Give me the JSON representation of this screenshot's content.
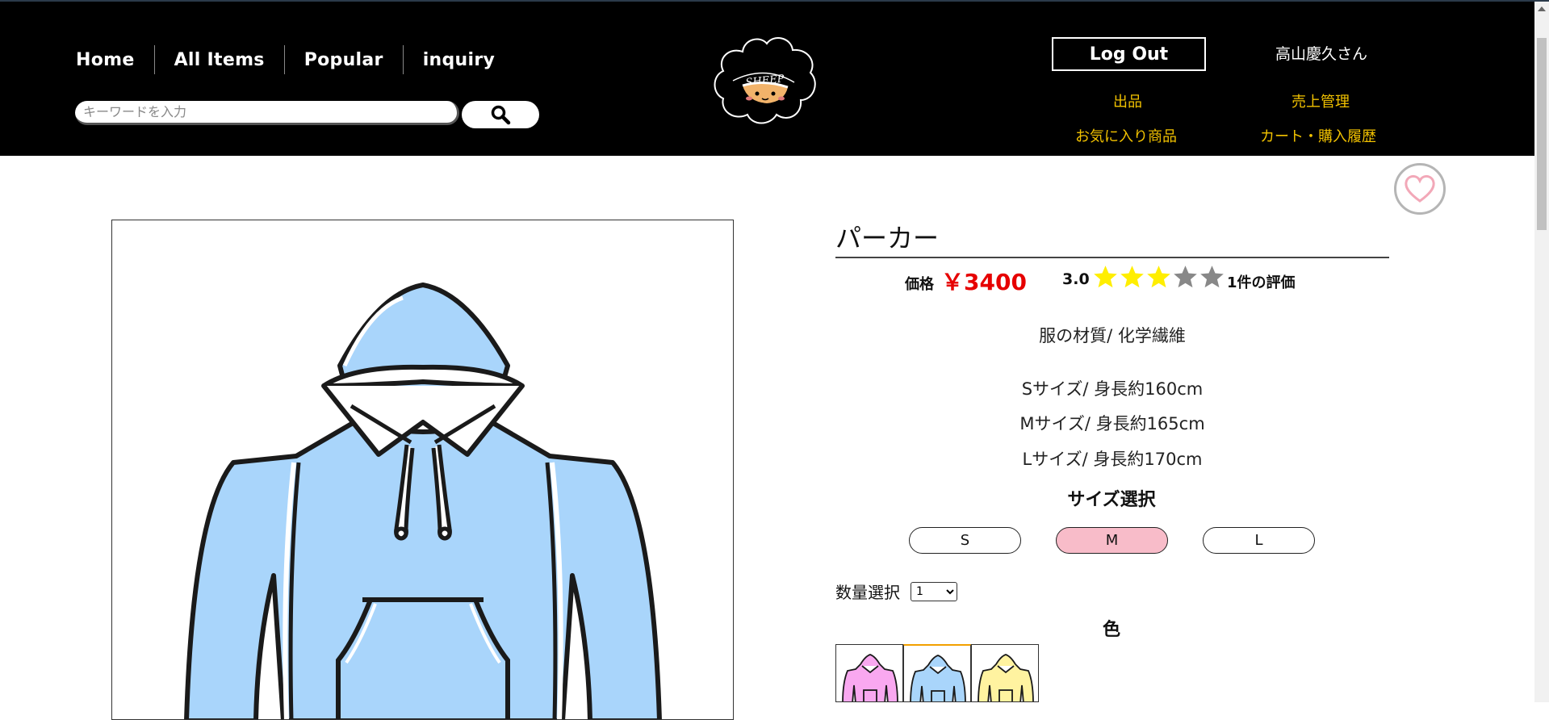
{
  "nav": {
    "items": [
      "Home",
      "All Items",
      "Popular",
      "inquiry"
    ]
  },
  "search": {
    "placeholder": "キーワードを入力"
  },
  "logo": {
    "text": "SHEEP"
  },
  "account": {
    "logout_label": "Log Out",
    "user_name": "高山慶久さん",
    "links": [
      "出品",
      "売上管理",
      "お気に入り商品",
      "カート・購入履歴"
    ]
  },
  "product": {
    "title": "パーカー",
    "price_label": "価格",
    "price_value": "￥3400",
    "rating_value": "3.0",
    "rating_stars": 3,
    "rating_max": 5,
    "rating_count_label": "1件の評価",
    "material": "服の材質/ 化学繊維",
    "sizes_info": [
      "Sサイズ/ 身長約160cm",
      "Mサイズ/ 身長約165cm",
      "Lサイズ/ 身長約170cm"
    ],
    "size_heading": "サイズ選択",
    "size_options": [
      "S",
      "M",
      "L"
    ],
    "selected_size": "M",
    "quantity_label": "数量選択",
    "quantity_value": "1",
    "color_heading": "色",
    "color_options": [
      "pink",
      "blue",
      "yellow"
    ],
    "selected_color": "blue"
  },
  "colors": {
    "header_bg": "#000000",
    "link_yellow": "#f2c200",
    "price_red": "#e60000",
    "star_yellow": "#ffee00",
    "star_gray": "#888888",
    "size_active": "#f8bcc9",
    "hoodie_blue": "#a9d5fb",
    "hoodie_pink": "#f9a8f0",
    "hoodie_yellow": "#fff3a0"
  }
}
